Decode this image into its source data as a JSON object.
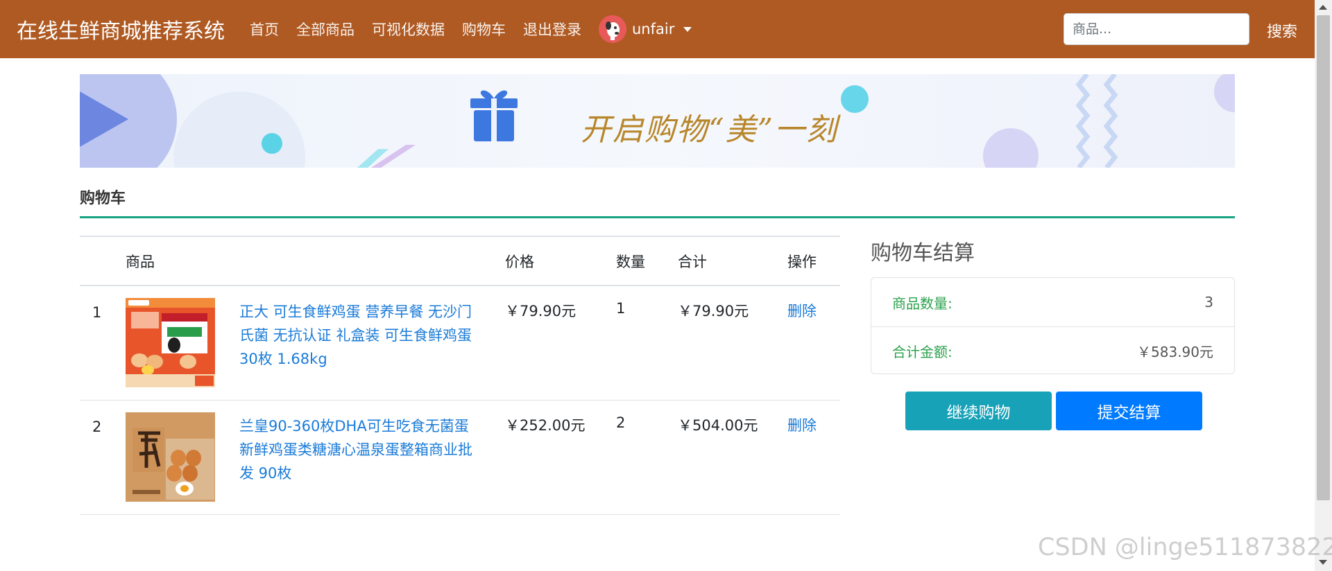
{
  "navbar": {
    "brand": "在线生鲜商城推荐系统",
    "links": [
      "首页",
      "全部商品",
      "可视化数据",
      "购物车",
      "退出登录"
    ],
    "username": "unfair",
    "search_placeholder": "商品...",
    "search_button": "搜索"
  },
  "banner": {
    "text": "开启购物“美”一刻"
  },
  "cart": {
    "title": "购物车",
    "columns": [
      "",
      "商品",
      "",
      "价格",
      "数量",
      "合计",
      "操作"
    ],
    "items": [
      {
        "index": "1",
        "name": "正大 可生食鲜鸡蛋 营养早餐 无沙门氏菌 无抗认证 礼盒装 可生食鲜鸡蛋 30枚 1.68kg",
        "price": "￥79.90元",
        "quantity": "1",
        "subtotal": "￥79.90元",
        "action": "删除"
      },
      {
        "index": "2",
        "name": "兰皇90-360枚DHA可生吃食无菌蛋新鲜鸡蛋类糖溏心温泉蛋整箱商业批发 90枚",
        "price": "￥252.00元",
        "quantity": "2",
        "subtotal": "￥504.00元",
        "action": "删除"
      }
    ]
  },
  "summary": {
    "title": "购物车结算",
    "count_label": "商品数量:",
    "count_value": "3",
    "total_label": "合计金额:",
    "total_value": "￥583.90元",
    "continue_button": "继续购物",
    "checkout_button": "提交结算"
  },
  "watermark": "CSDN @linge511873822",
  "colors": {
    "navbar": "#af5a23",
    "accent_line": "#15a383",
    "link": "#1a7bd8",
    "continue": "#17a2b8",
    "checkout": "#007bff",
    "summary_label": "#2ba24c"
  }
}
